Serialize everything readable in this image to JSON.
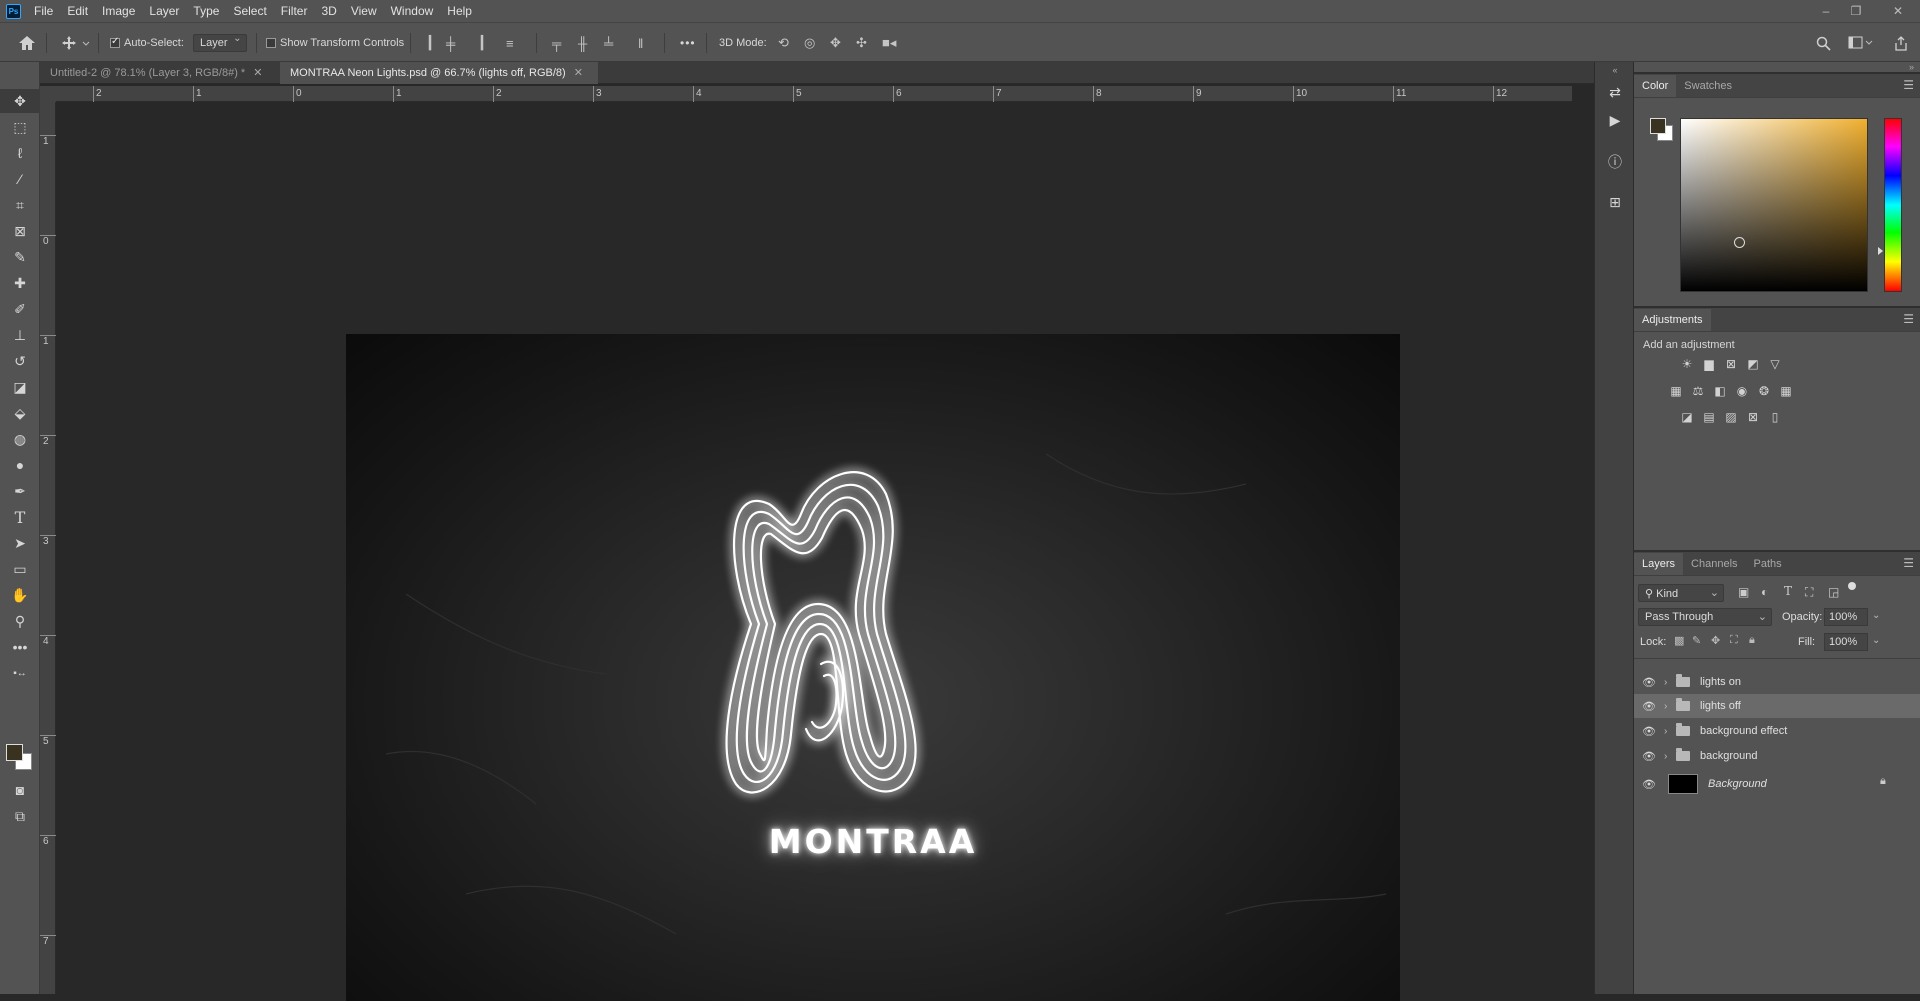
{
  "app": {
    "logo": "Ps"
  },
  "menu": [
    "File",
    "Edit",
    "Image",
    "Layer",
    "Type",
    "Select",
    "Filter",
    "3D",
    "View",
    "Window",
    "Help"
  ],
  "window_controls": {
    "minimize": "–",
    "restore": "❐",
    "close": "✕"
  },
  "options": {
    "auto_select_label": "Auto-Select:",
    "auto_select_checked": true,
    "auto_select_target": "Layer",
    "show_transform_label": "Show Transform Controls",
    "show_transform_checked": false,
    "more": "•••",
    "mode_3d_label": "3D Mode:"
  },
  "tabs": [
    {
      "label": "Untitled-2 @ 78.1% (Layer 3, RGB/8#) *",
      "active": false
    },
    {
      "label": "MONTRAA Neon Lights.psd @ 66.7% (lights off, RGB/8)",
      "active": true
    }
  ],
  "ruler_top": [
    "2",
    "1",
    "0",
    "1",
    "2",
    "3",
    "4",
    "5",
    "6",
    "7",
    "8",
    "9",
    "10",
    "11",
    "12"
  ],
  "ruler_left": [
    "1",
    "0",
    "1",
    "2",
    "3",
    "4",
    "5",
    "6",
    "7"
  ],
  "artwork": {
    "wordmark": "MONTRAA"
  },
  "color_panel": {
    "tabs": [
      "Color",
      "Swatches"
    ],
    "foreground": "#3a3220",
    "background": "#ffffff",
    "hue_color": "#f0b030"
  },
  "adjustments_panel": {
    "title": "Adjustments",
    "subtitle": "Add an adjustment"
  },
  "layers_panel": {
    "tabs": [
      "Layers",
      "Channels",
      "Paths"
    ],
    "filter_kind": "Kind",
    "blend_mode": "Pass Through",
    "opacity_label": "Opacity:",
    "opacity_value": "100%",
    "lock_label": "Lock:",
    "fill_label": "Fill:",
    "fill_value": "100%",
    "layers": [
      {
        "name": "lights on",
        "type": "group",
        "selected": false
      },
      {
        "name": "lights off",
        "type": "group",
        "selected": true
      },
      {
        "name": "background effect",
        "type": "group",
        "selected": false
      },
      {
        "name": "background",
        "type": "group",
        "selected": false
      },
      {
        "name": "Background",
        "type": "image",
        "selected": false,
        "locked": true
      }
    ]
  }
}
